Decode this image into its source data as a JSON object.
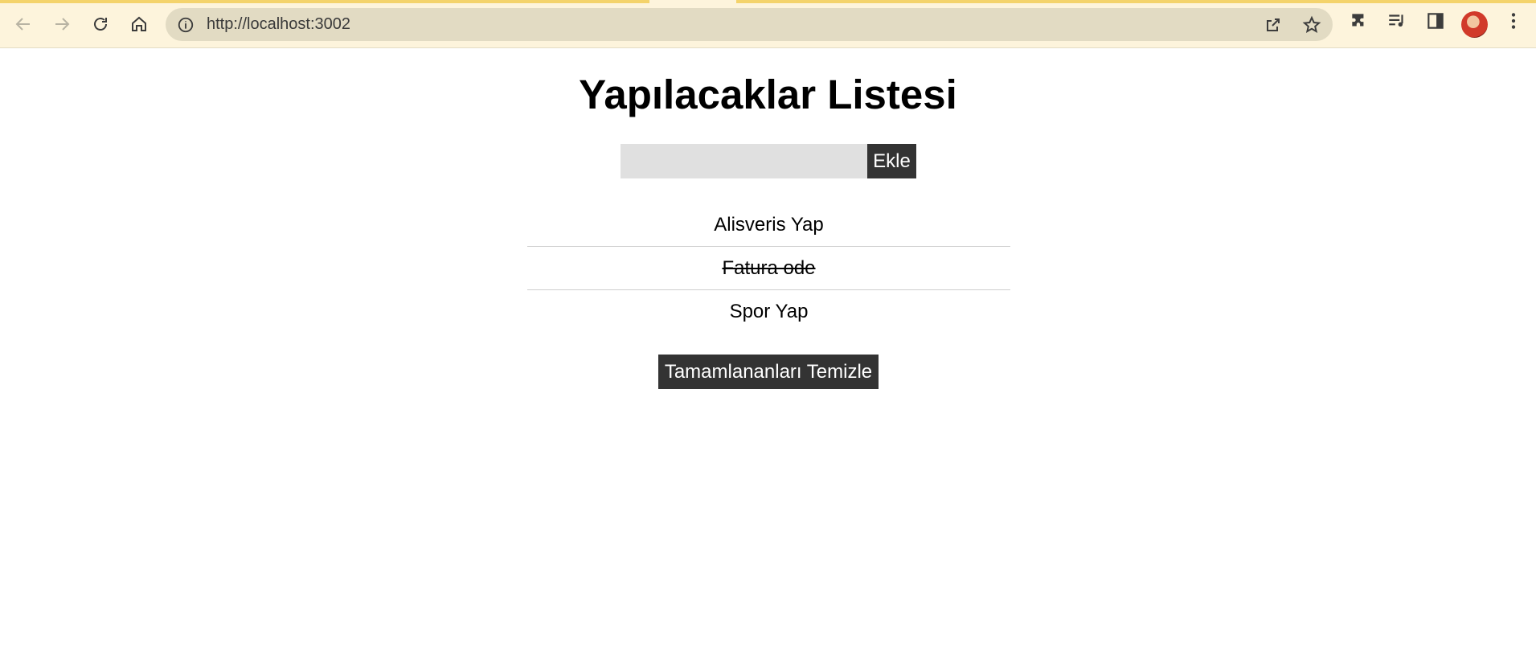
{
  "browser": {
    "url": "http://localhost:3002",
    "toolbar_icons": [
      "back-icon",
      "forward-icon",
      "reload-icon",
      "home-icon"
    ],
    "omnibox_icons": [
      "info-icon",
      "share-icon",
      "star-icon"
    ],
    "extension_icons": [
      "puzzle-icon",
      "reading-list-icon",
      "side-panel-icon",
      "avatar",
      "menu-icon"
    ],
    "accent_color": "#f4d36b",
    "chrome_background": "#fdf4dc"
  },
  "page": {
    "title": "Yapılacaklar Listesi",
    "input": {
      "value": "",
      "placeholder": ""
    },
    "add_button_label": "Ekle",
    "todos": [
      {
        "text": "Alisveris Yap",
        "completed": false
      },
      {
        "text": "Fatura ode",
        "completed": true
      },
      {
        "text": "Spor Yap",
        "completed": false
      }
    ],
    "clear_button_label": "Tamamlananları Temizle",
    "button_color": "#333333",
    "input_color": "#e0e0e0"
  }
}
